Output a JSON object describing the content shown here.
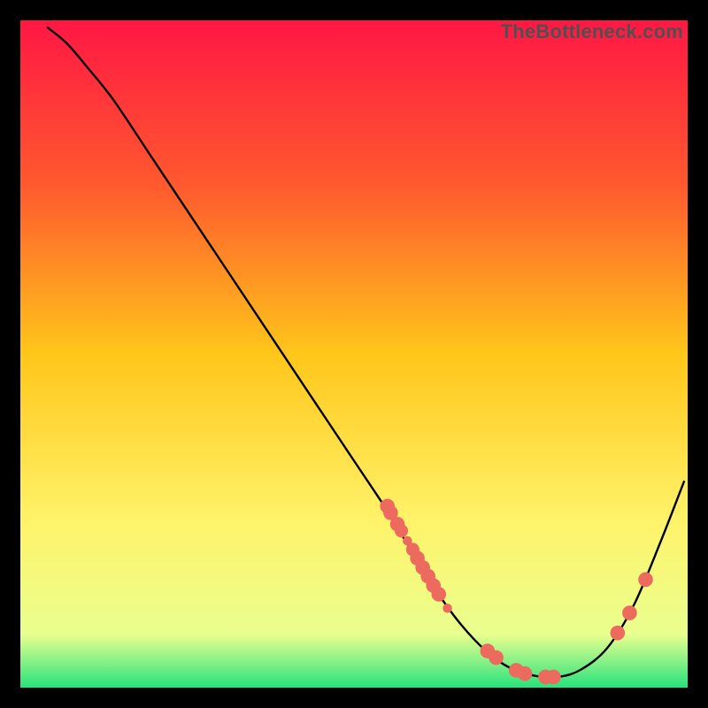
{
  "watermark": "TheBottleneck.com",
  "chart_data": {
    "type": "line",
    "title": "",
    "xlabel": "",
    "ylabel": "",
    "xlim": [
      0,
      100
    ],
    "ylim": [
      0,
      100
    ],
    "grid": false,
    "legend": false,
    "gradient_stops": [
      {
        "offset": 0,
        "color": "#ff1744"
      },
      {
        "offset": 25,
        "color": "#ff5a2e"
      },
      {
        "offset": 50,
        "color": "#ffc61a"
      },
      {
        "offset": 75,
        "color": "#fff36a"
      },
      {
        "offset": 92,
        "color": "#e9ff8f"
      },
      {
        "offset": 100,
        "color": "#27e37d"
      }
    ],
    "curve": [
      {
        "x": 4.0,
        "y": 99.0
      },
      {
        "x": 7.0,
        "y": 96.5
      },
      {
        "x": 10.0,
        "y": 93.0
      },
      {
        "x": 14.0,
        "y": 88.0
      },
      {
        "x": 20.0,
        "y": 79.0
      },
      {
        "x": 28.0,
        "y": 67.0
      },
      {
        "x": 36.0,
        "y": 55.0
      },
      {
        "x": 44.0,
        "y": 43.0
      },
      {
        "x": 50.0,
        "y": 34.0
      },
      {
        "x": 55.0,
        "y": 26.5
      },
      {
        "x": 58.0,
        "y": 21.5
      },
      {
        "x": 62.0,
        "y": 15.0
      },
      {
        "x": 66.0,
        "y": 9.5
      },
      {
        "x": 70.0,
        "y": 5.3
      },
      {
        "x": 73.5,
        "y": 2.9
      },
      {
        "x": 77.0,
        "y": 1.8
      },
      {
        "x": 80.5,
        "y": 1.6
      },
      {
        "x": 84.0,
        "y": 2.7
      },
      {
        "x": 88.0,
        "y": 6.0
      },
      {
        "x": 92.0,
        "y": 12.5
      },
      {
        "x": 96.0,
        "y": 22.0
      },
      {
        "x": 99.5,
        "y": 31.0
      }
    ],
    "markers": [
      {
        "x": 55.0,
        "y": 27.2,
        "r": 1.1
      },
      {
        "x": 55.5,
        "y": 26.2,
        "r": 1.1
      },
      {
        "x": 56.5,
        "y": 24.5,
        "r": 1.1
      },
      {
        "x": 57.1,
        "y": 23.5,
        "r": 1.0
      },
      {
        "x": 58.0,
        "y": 22.0,
        "r": 0.7
      },
      {
        "x": 58.8,
        "y": 20.7,
        "r": 1.0
      },
      {
        "x": 59.5,
        "y": 19.4,
        "r": 1.1
      },
      {
        "x": 60.3,
        "y": 18.0,
        "r": 1.1
      },
      {
        "x": 61.1,
        "y": 16.7,
        "r": 1.1
      },
      {
        "x": 61.9,
        "y": 15.3,
        "r": 1.1
      },
      {
        "x": 62.7,
        "y": 14.0,
        "r": 1.1
      },
      {
        "x": 64.0,
        "y": 11.9,
        "r": 0.7
      },
      {
        "x": 70.0,
        "y": 5.5,
        "r": 1.1
      },
      {
        "x": 71.3,
        "y": 4.5,
        "r": 1.1
      },
      {
        "x": 74.3,
        "y": 2.6,
        "r": 1.1
      },
      {
        "x": 75.6,
        "y": 2.1,
        "r": 1.1
      },
      {
        "x": 78.7,
        "y": 1.6,
        "r": 1.1
      },
      {
        "x": 79.9,
        "y": 1.6,
        "r": 1.1
      },
      {
        "x": 89.5,
        "y": 8.2,
        "r": 1.1
      },
      {
        "x": 91.3,
        "y": 11.2,
        "r": 1.1
      },
      {
        "x": 93.7,
        "y": 16.2,
        "r": 1.1
      }
    ],
    "marker_color": "#ed6a5e"
  }
}
